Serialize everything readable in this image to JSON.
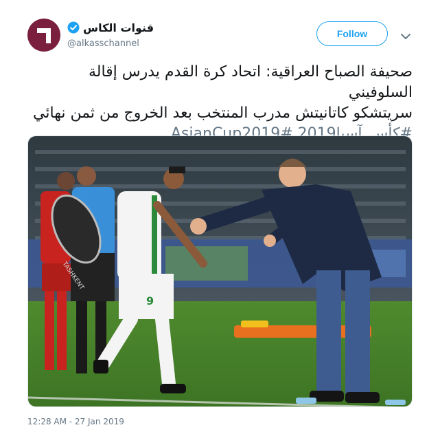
{
  "author": {
    "display_name": "قنوات الكاس",
    "handle": "@alkasschannel",
    "verified_icon": "verified-badge-icon",
    "avatar_color": "#7a1f3d"
  },
  "actions": {
    "follow_label": "Follow",
    "menu_icon": "chevron-down-icon"
  },
  "tweet": {
    "line1": "صحيفة الصباح العراقية: اتحاد كرة القدم يدرس إقالة السلوفيني",
    "line2": "سريتشكو كاتانيتش مدرب المنتخب بعد الخروج من ثمن نهائي",
    "hashtags": "#كأس_آسيا2019 #AsianCup2019",
    "hashtag_color": "#657786"
  },
  "media": {
    "sign_text": "TASHKENT",
    "jersey_number": "9"
  },
  "footer": {
    "timestamp": "12:28 AM - 27 Jan 2019"
  },
  "colors": {
    "accent": "#1da1f2",
    "muted": "#657786"
  }
}
